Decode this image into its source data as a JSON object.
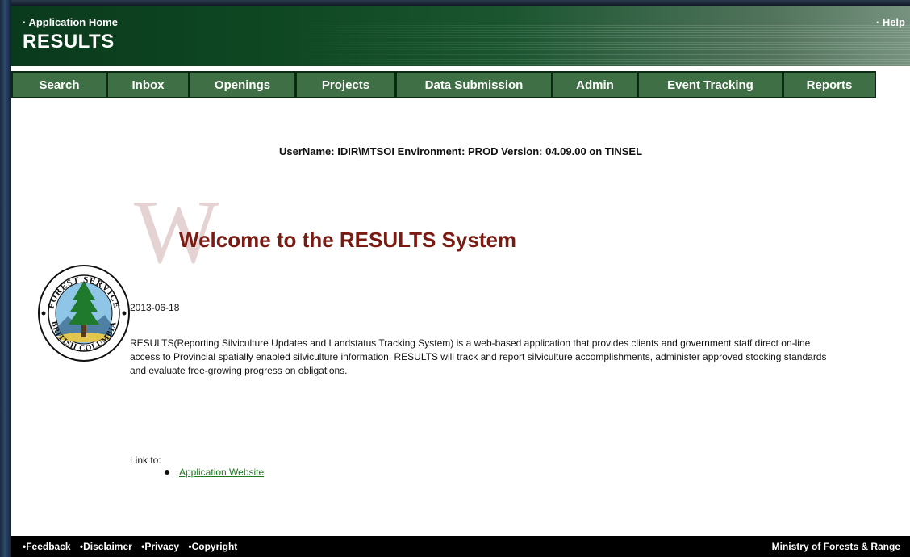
{
  "header": {
    "home_link": "· Application Home",
    "help_link": "· Help",
    "app_title": "RESULTS"
  },
  "nav": {
    "tabs": [
      "Search",
      "Inbox",
      "Openings",
      "Projects",
      "Data Submission",
      "Admin",
      "Event Tracking",
      "Reports"
    ]
  },
  "user_info": "UserName: IDIR\\MTSOI  Environment: PROD  Version: 04.09.00 on TINSEL",
  "welcome": {
    "drop_letter": "W",
    "title": "Welcome to the RESULTS System",
    "seal_text_top": "FOREST SERVICE",
    "seal_text_bottom": "BRITISH COLUMBIA"
  },
  "content": {
    "date": "2013-06-18",
    "description": "RESULTS(Reporting Silviculture Updates and Landstatus Tracking System) is a web-based application that provides clients and government staff direct on-line access to Provincial spatially enabled silviculture information. RESULTS will track and report silviculture accomplishments, administer approved stocking standards and evaluate free-growing progress on obligations.",
    "link_label": "Link to:",
    "links": [
      "Application Website"
    ]
  },
  "footer": {
    "links": [
      "•Feedback",
      "•Disclaimer",
      "•Privacy",
      "•Copyright"
    ],
    "ministry": "Ministry of Forests & Range"
  },
  "colors": {
    "header_green": "#0b3a1c",
    "nav_green": "#3f6f45",
    "welcome_red": "#7a1a12",
    "link_green": "#1f7a1f"
  }
}
